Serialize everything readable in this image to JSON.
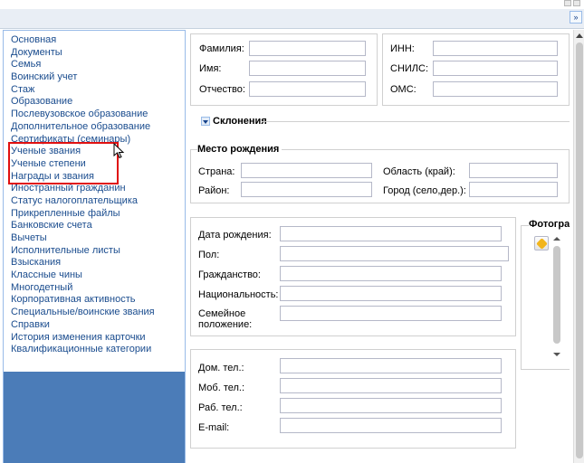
{
  "window": {
    "collapse_label": "»"
  },
  "sidebar": {
    "items": [
      "Основная",
      "Документы",
      "Семья",
      "Воинский учет",
      "Стаж",
      "Образование",
      "Послевузовское образование",
      "Дополнительное образование",
      "Сертификаты (семинары)",
      "Ученые звания",
      "Ученые степени",
      "Награды и звания",
      "Иностранный гражданин",
      "Статус налогоплательщика",
      "Прикрепленные файлы",
      "Банковские счета",
      "Вычеты",
      "Исполнительные листы",
      "Взыскания",
      "Классные чины",
      "Многодетный",
      "Корпоративная активность",
      "Специальные/воинские звания",
      "Справки",
      "История изменения карточки",
      "Квалификационные категории"
    ],
    "colors": {
      "link": "#1a4c8e",
      "footer": "#4b7cb8",
      "highlight": "#e01010"
    }
  },
  "name_block": {
    "surname_label": "Фамилия:",
    "surname_value": "",
    "name_label": "Имя:",
    "name_value": "",
    "patronymic_label": "Отчество:",
    "patronymic_value": ""
  },
  "ids_block": {
    "inn_label": "ИНН:",
    "inn_value": "",
    "snils_label": "СНИЛС:",
    "snils_value": "",
    "oms_label": "ОМС:",
    "oms_value": ""
  },
  "declension": {
    "label": "Склонения"
  },
  "birthplace": {
    "legend": "Место рождения",
    "country_label": "Страна:",
    "country_value": "",
    "region_label": "Область (край):",
    "region_value": "",
    "district_label": "Район:",
    "district_value": "",
    "city_label": "Город (село,дер.):",
    "city_value": ""
  },
  "personal": {
    "birthdate_label": "Дата рождения:",
    "birthdate_value": "",
    "gender_label": "Пол:",
    "gender_value": "",
    "citizenship_label": "Гражданство:",
    "citizenship_value": "",
    "nationality_label": "Национальность:",
    "nationality_value": "",
    "marital_label_1": "Семейное",
    "marital_label_2": "положение:",
    "marital_value": ""
  },
  "photo": {
    "legend": "Фотограф"
  },
  "contacts": {
    "home_label": "Дом. тел.:",
    "home_value": "",
    "mobile_label": "Моб. тел.:",
    "mobile_value": "",
    "work_label": "Раб. тел.:",
    "work_value": "",
    "email_label": "E-mail:",
    "email_value": ""
  }
}
